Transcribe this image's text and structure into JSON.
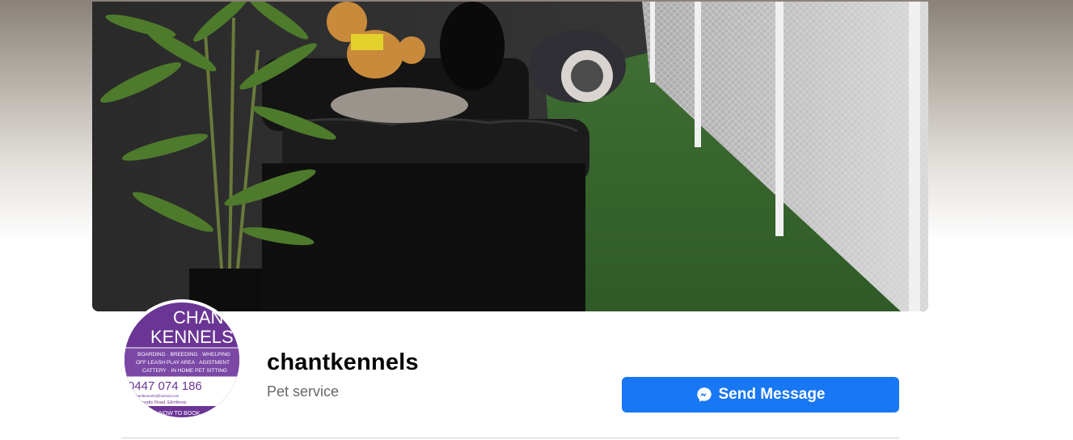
{
  "page": {
    "name": "chantkennels",
    "category": "Pet service"
  },
  "actions": {
    "send_message_label": "Send Message"
  },
  "profile_picture": {
    "logo_text_line1": "CHANT",
    "logo_text_line2": "KENNELS",
    "services_line1": "BOARDING · BREEDING · WHELPING",
    "services_line2": "OFF LEASH PLAY AREA · AGISTMENT",
    "services_line3": "CATTERY · IN HOME PET SITTING",
    "phone": "0447 074 186",
    "email": "chantkennels@hotmail.com",
    "address": "Spratts Road, Elimthorp",
    "cta": "EMAIL NOW TO BOOK"
  },
  "icons": {
    "send_message": "messenger-icon"
  },
  "colors": {
    "button_bg": "#1877f2",
    "button_text": "#ffffff",
    "name_text": "#050505",
    "category_text": "#65676b",
    "logo_purple": "#6a3594"
  }
}
